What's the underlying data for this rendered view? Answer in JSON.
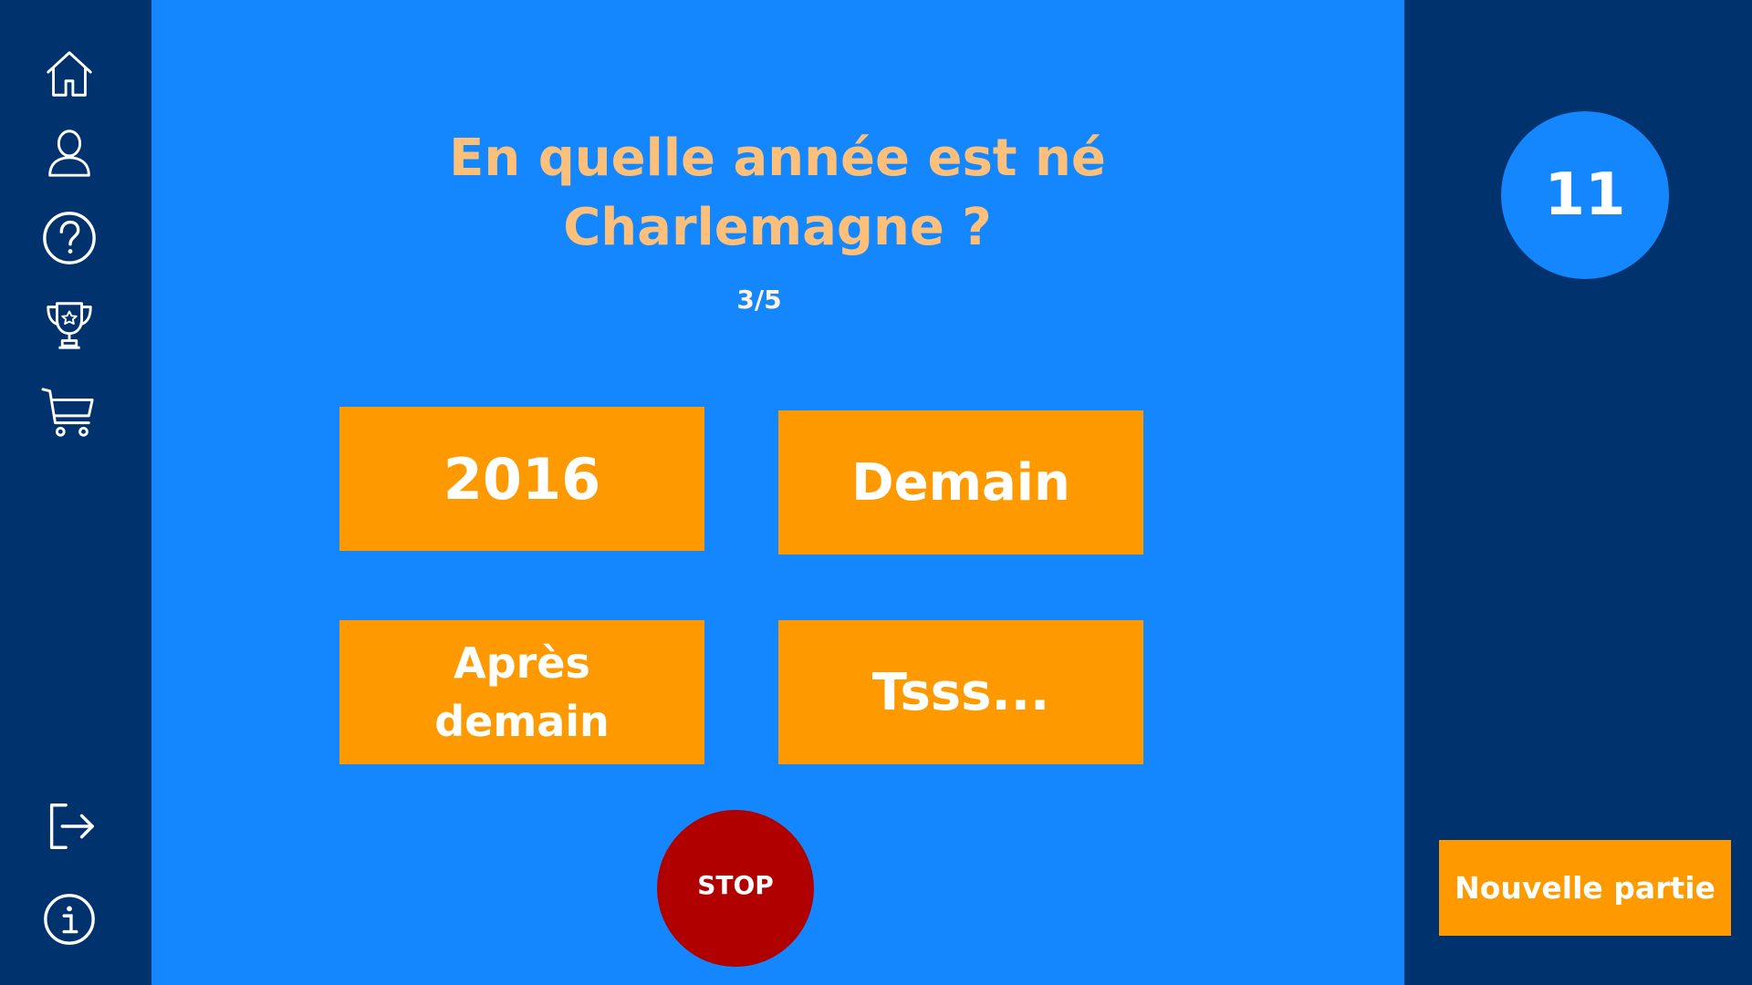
{
  "sidebar": {
    "items": [
      {
        "icon": "home-icon"
      },
      {
        "icon": "user-icon"
      },
      {
        "icon": "help-icon"
      },
      {
        "icon": "trophy-icon"
      },
      {
        "icon": "cart-icon"
      },
      {
        "icon": "logout-icon"
      },
      {
        "icon": "info-icon"
      }
    ]
  },
  "quiz": {
    "question": "En quelle année est né Charlemagne ?",
    "progress": "3/5",
    "answers": [
      "2016",
      "Demain",
      "Après demain",
      "Tsss..."
    ],
    "stop_label": "STOP"
  },
  "score": {
    "value": "11"
  },
  "new_game": {
    "label": "Nouvelle partie"
  },
  "colors": {
    "sidebar_bg": "#00326e",
    "main_bg": "#1487ff",
    "answer_bg": "#ff9900",
    "question_text": "#fcc07a",
    "stop_bg": "#b00000"
  }
}
